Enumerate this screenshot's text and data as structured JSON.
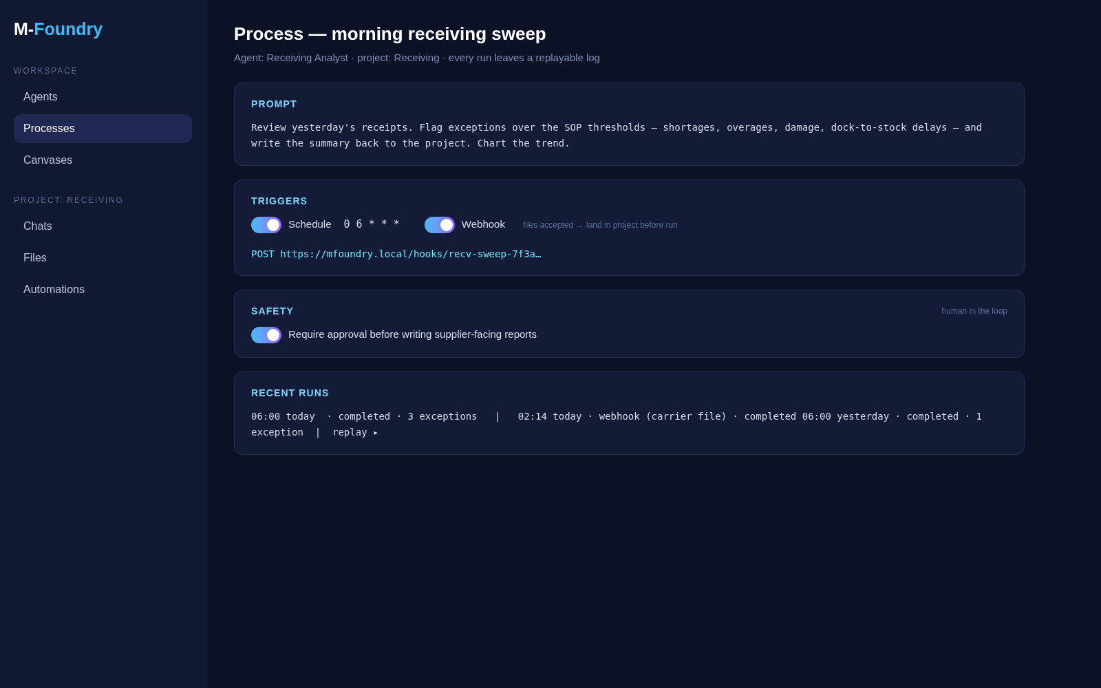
{
  "brand": {
    "prefix": "M-",
    "name": "Foundry"
  },
  "sidebar": {
    "sections": [
      {
        "heading": "WORKSPACE",
        "items": [
          {
            "label": "Agents",
            "selected": false
          },
          {
            "label": "Processes",
            "selected": true
          },
          {
            "label": "Canvases",
            "selected": false
          }
        ]
      },
      {
        "heading": "PROJECT: RECEIVING",
        "items": [
          {
            "label": "Chats",
            "selected": false
          },
          {
            "label": "Files",
            "selected": false
          },
          {
            "label": "Automations",
            "selected": false
          }
        ]
      }
    ]
  },
  "title": "Process — morning receiving sweep",
  "subtitle": "Agent: Receiving Analyst · project: Receiving · every run leaves a replayable log",
  "prompt": {
    "heading": "PROMPT",
    "text": "Review yesterday's receipts. Flag exceptions over the SOP thresholds — shortages, overages, damage, dock-to-stock delays — and write the summary back to the project. Chart the trend."
  },
  "triggers": {
    "heading": "TRIGGERS",
    "items": [
      {
        "label": "Schedule",
        "on": true,
        "detail": "0 6 * * *",
        "kind": "cron"
      },
      {
        "label": "Webhook",
        "on": true,
        "detail": "files accepted → land in project before run",
        "kind": "note"
      }
    ],
    "endpoint": "POST https://mfoundry.local/hooks/recv-sweep-7f3a…"
  },
  "safety": {
    "heading": "SAFETY",
    "note": "human in the loop",
    "toggle": {
      "label": "Require approval before writing supplier-facing reports",
      "on": true
    }
  },
  "recent_runs": {
    "heading": "RECENT RUNS",
    "text": "06:00 today  · completed · 3 exceptions   |   02:14 today · webhook (carrier file) · completed 06:00 yesterday · completed · 1 exception  |  replay ▸"
  }
}
